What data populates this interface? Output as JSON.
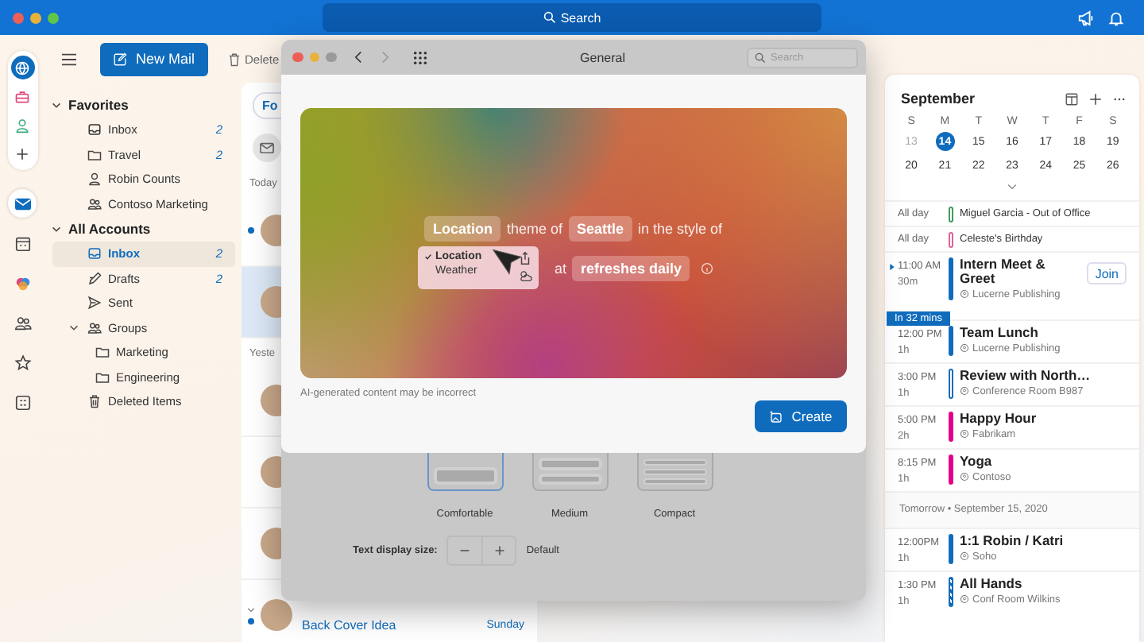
{
  "top_bar": {
    "search": {
      "placeholder": "Search"
    }
  },
  "rail": {
    "accounts": [
      {
        "kind": "globe",
        "selected": true
      },
      {
        "kind": "briefcase",
        "selected": false
      },
      {
        "kind": "person",
        "selected": false
      },
      {
        "kind": "add",
        "selected": false
      }
    ],
    "apps": [
      {
        "kind": "mail",
        "selected": true
      },
      {
        "kind": "calendar",
        "selected": false
      },
      {
        "kind": "copilot",
        "selected": false
      },
      {
        "kind": "people",
        "selected": false
      },
      {
        "kind": "favorites",
        "selected": false
      },
      {
        "kind": "apps",
        "selected": false
      }
    ]
  },
  "toolbar": {
    "new_mail": "New Mail",
    "delete": "Delete"
  },
  "folders": {
    "sections": [
      {
        "title": "Favorites",
        "expanded": true,
        "items": [
          {
            "name": "Inbox",
            "kind": "inbox",
            "count": "2",
            "selected": false
          },
          {
            "name": "Travel",
            "kind": "folder",
            "count": "2",
            "selected": false
          },
          {
            "name": "Robin Counts",
            "kind": "person",
            "selected": false
          },
          {
            "name": "Contoso Marketing",
            "kind": "people",
            "selected": false
          }
        ]
      },
      {
        "title": "All Accounts",
        "expanded": true,
        "items": [
          {
            "name": "Inbox",
            "kind": "inbox",
            "count": "2",
            "selected": true
          },
          {
            "name": "Drafts",
            "kind": "drafts",
            "count": "2",
            "selected": false
          },
          {
            "name": "Sent",
            "kind": "sent",
            "selected": false
          },
          {
            "name": "Groups",
            "kind": "people",
            "selected": false,
            "expanded": true,
            "children": [
              {
                "name": "Marketing",
                "kind": "folder",
                "selected": false
              },
              {
                "name": "Engineering",
                "kind": "folder",
                "selected": false
              }
            ]
          },
          {
            "name": "Deleted Items",
            "kind": "trash",
            "selected": false
          }
        ]
      }
    ]
  },
  "message_list": {
    "tab": "Fo",
    "groups": [
      {
        "label": "Today",
        "items": [
          {
            "unread": true,
            "selected": false,
            "thread": false
          },
          {
            "unread": false,
            "selected": true,
            "thread": false
          }
        ]
      },
      {
        "label": "Yeste",
        "items": [
          {
            "unread": false,
            "selected": false,
            "thread": false
          },
          {
            "unread": false,
            "selected": false,
            "thread": false
          },
          {
            "unread": false,
            "selected": false,
            "thread": false
          },
          {
            "unread": true,
            "selected": false,
            "thread": true,
            "subject": "Back Cover Idea",
            "date": "Sunday"
          }
        ]
      }
    ]
  },
  "calendar": {
    "month": "September",
    "weekdays": [
      "S",
      "M",
      "T",
      "W",
      "T",
      "F",
      "S"
    ],
    "weeks": [
      [
        {
          "day": "13",
          "muted": true,
          "selected": false
        },
        {
          "day": "14",
          "muted": false,
          "selected": true
        },
        {
          "day": "15",
          "muted": false,
          "selected": false
        },
        {
          "day": "16",
          "muted": false,
          "selected": false
        },
        {
          "day": "17",
          "muted": false,
          "selected": false
        },
        {
          "day": "18",
          "muted": false,
          "selected": false
        },
        {
          "day": "19",
          "muted": false,
          "selected": false
        }
      ],
      [
        {
          "day": "20",
          "muted": false,
          "selected": false
        },
        {
          "day": "21",
          "muted": false,
          "selected": false
        },
        {
          "day": "22",
          "muted": false,
          "selected": false
        },
        {
          "day": "23",
          "muted": false,
          "selected": false
        },
        {
          "day": "24",
          "muted": false,
          "selected": false
        },
        {
          "day": "25",
          "muted": false,
          "selected": false
        },
        {
          "day": "26",
          "muted": false,
          "selected": false
        }
      ]
    ],
    "events": [
      {
        "kind": "allday",
        "time": "All day",
        "title": "Miguel Garcia - Out of Office",
        "color": "#3f9b5f",
        "outlined": true,
        "striped": false
      },
      {
        "kind": "allday",
        "time": "All day",
        "title": "Celeste's Birthday",
        "color": "#e0609a",
        "outlined": true,
        "striped": false
      },
      {
        "kind": "timed",
        "time": "11:00 AM",
        "duration": "30m",
        "title": "Intern Meet & Greet",
        "location": "Lucerne Publishing",
        "color": "#0f6cbd",
        "outlined": false,
        "striped": false,
        "now": true,
        "join": "Join",
        "badge": "In 32 mins"
      },
      {
        "kind": "timed",
        "time": "12:00 PM",
        "duration": "1h",
        "title": "Team Lunch",
        "location": "Lucerne Publishing",
        "color": "#0f6cbd",
        "outlined": false,
        "striped": false,
        "now": false
      },
      {
        "kind": "timed",
        "time": "3:00 PM",
        "duration": "1h",
        "title": "Review with North…",
        "location": "Conference Room B987",
        "color": "#0f6cbd",
        "outlined": true,
        "striped": false,
        "now": false
      },
      {
        "kind": "timed",
        "time": "5:00 PM",
        "duration": "2h",
        "title": "Happy Hour",
        "location": "Fabrikam",
        "color": "#e3008c",
        "outlined": false,
        "striped": false,
        "now": false
      },
      {
        "kind": "timed",
        "time": "8:15 PM",
        "duration": "1h",
        "title": "Yoga",
        "location": "Contoso",
        "color": "#e3008c",
        "outlined": false,
        "striped": false,
        "now": false
      },
      {
        "kind": "header",
        "title": "Tomorrow • September 15, 2020"
      },
      {
        "kind": "timed",
        "time": "12:00PM",
        "duration": "1h",
        "title": "1:1 Robin / Katri",
        "location": "Soho",
        "color": "#0f6cbd",
        "outlined": false,
        "striped": false,
        "now": false
      },
      {
        "kind": "timed",
        "time": "1:30 PM",
        "duration": "1h",
        "title": "All Hands",
        "location": "Conf Room Wilkins",
        "color": "#0f6cbd",
        "outlined": true,
        "striped": true,
        "now": false
      }
    ]
  },
  "dialog": {
    "title": "General",
    "search": {
      "placeholder": "Search"
    },
    "prompt_line_1": [
      {
        "kind": "chip",
        "text": "Location"
      },
      {
        "kind": "text",
        "text": "theme of"
      },
      {
        "kind": "chip",
        "text": "Seattle"
      },
      {
        "kind": "text",
        "text": "in the style of"
      }
    ],
    "menu": [
      {
        "label": "Location",
        "selected": true
      },
      {
        "label": "Weather",
        "selected": false
      }
    ],
    "prompt_line_2": [
      {
        "kind": "text",
        "text": "at"
      },
      {
        "kind": "chip",
        "text": "refreshes daily"
      }
    ],
    "disclaimer": "AI-generated content may be incorrect",
    "create": "Create",
    "density": [
      {
        "label": "Comfortable",
        "kind": "comfortable",
        "selected": true
      },
      {
        "label": "Medium",
        "kind": "medium",
        "selected": false
      },
      {
        "label": "Compact",
        "kind": "compact",
        "selected": false
      }
    ],
    "text_size": {
      "label": "Text display size:",
      "value": "Default"
    }
  }
}
